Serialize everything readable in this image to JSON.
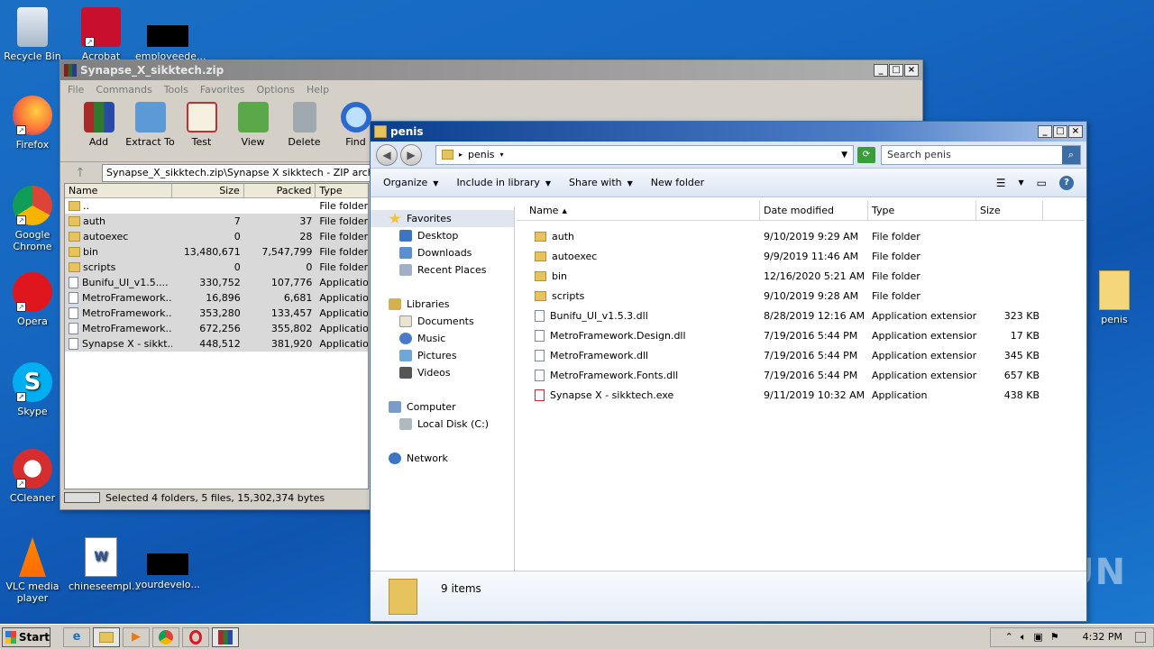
{
  "desktop": {
    "icons": [
      {
        "label": "Recycle Bin"
      },
      {
        "label": "Acrobat"
      },
      {
        "label": "employeede..."
      },
      {
        "label": "Firefox"
      },
      {
        "label": "Google Chrome"
      },
      {
        "label": "Opera"
      },
      {
        "label": "Skype"
      },
      {
        "label": "CCleaner"
      },
      {
        "label": "VLC media player"
      },
      {
        "label": "chineseempl..."
      },
      {
        "label": "yourdevelo..."
      },
      {
        "label": "penis"
      }
    ],
    "watermark": "ANY RUN"
  },
  "winrar": {
    "title": "Synapse_X_sikktech.zip",
    "menu": [
      "File",
      "Commands",
      "Tools",
      "Favorites",
      "Options",
      "Help"
    ],
    "tools": [
      "Add",
      "Extract To",
      "Test",
      "View",
      "Delete",
      "Find"
    ],
    "path": "Synapse_X_sikktech.zip\\Synapse X sikktech - ZIP archi",
    "columns": {
      "name": "Name",
      "size": "Size",
      "packed": "Packed",
      "type": "Type"
    },
    "rows": [
      {
        "name": "..",
        "size": "",
        "packed": "",
        "type": "File folder",
        "kind": "folder"
      },
      {
        "name": "auth",
        "size": "7",
        "packed": "37",
        "type": "File folder",
        "kind": "folder"
      },
      {
        "name": "autoexec",
        "size": "0",
        "packed": "28",
        "type": "File folder",
        "kind": "folder"
      },
      {
        "name": "bin",
        "size": "13,480,671",
        "packed": "7,547,799",
        "type": "File folder",
        "kind": "folder"
      },
      {
        "name": "scripts",
        "size": "0",
        "packed": "0",
        "type": "File folder",
        "kind": "folder"
      },
      {
        "name": "Bunifu_UI_v1.5....",
        "size": "330,752",
        "packed": "107,776",
        "type": "Application",
        "kind": "file"
      },
      {
        "name": "MetroFramework...",
        "size": "16,896",
        "packed": "6,681",
        "type": "Application",
        "kind": "file"
      },
      {
        "name": "MetroFramework...",
        "size": "353,280",
        "packed": "133,457",
        "type": "Application",
        "kind": "file"
      },
      {
        "name": "MetroFramework...",
        "size": "672,256",
        "packed": "355,802",
        "type": "Application",
        "kind": "file"
      },
      {
        "name": "Synapse X - sikkt...",
        "size": "448,512",
        "packed": "381,920",
        "type": "Application",
        "kind": "file"
      }
    ],
    "status": "Selected 4 folders, 5 files, 15,302,374 bytes"
  },
  "explorer": {
    "title": "penis",
    "address": "penis",
    "search_placeholder": "Search penis",
    "commands": [
      "Organize",
      "Include in library",
      "Share with",
      "New folder"
    ],
    "nav": {
      "favorites": "Favorites",
      "fav_items": [
        "Desktop",
        "Downloads",
        "Recent Places"
      ],
      "libraries": "Libraries",
      "lib_items": [
        "Documents",
        "Music",
        "Pictures",
        "Videos"
      ],
      "computer": "Computer",
      "comp_items": [
        "Local Disk (C:)"
      ],
      "network": "Network"
    },
    "columns": {
      "name": "Name",
      "date": "Date modified",
      "type": "Type",
      "size": "Size"
    },
    "files": [
      {
        "name": "auth",
        "date": "9/10/2019 9:29 AM",
        "type": "File folder",
        "size": "",
        "kind": "folder"
      },
      {
        "name": "autoexec",
        "date": "9/9/2019 11:46 AM",
        "type": "File folder",
        "size": "",
        "kind": "folder"
      },
      {
        "name": "bin",
        "date": "12/16/2020 5:21 AM",
        "type": "File folder",
        "size": "",
        "kind": "folder"
      },
      {
        "name": "scripts",
        "date": "9/10/2019 9:28 AM",
        "type": "File folder",
        "size": "",
        "kind": "folder"
      },
      {
        "name": "Bunifu_UI_v1.5.3.dll",
        "date": "8/28/2019 12:16 AM",
        "type": "Application extension",
        "size": "323 KB",
        "kind": "file"
      },
      {
        "name": "MetroFramework.Design.dll",
        "date": "7/19/2016 5:44 PM",
        "type": "Application extension",
        "size": "17 KB",
        "kind": "file"
      },
      {
        "name": "MetroFramework.dll",
        "date": "7/19/2016 5:44 PM",
        "type": "Application extension",
        "size": "345 KB",
        "kind": "file"
      },
      {
        "name": "MetroFramework.Fonts.dll",
        "date": "7/19/2016 5:44 PM",
        "type": "Application extension",
        "size": "657 KB",
        "kind": "file"
      },
      {
        "name": "Synapse X - sikktech.exe",
        "date": "9/11/2019 10:32 AM",
        "type": "Application",
        "size": "438 KB",
        "kind": "exe"
      }
    ],
    "item_count": "9 items"
  },
  "taskbar": {
    "start": "Start",
    "clock": "4:32 PM"
  }
}
